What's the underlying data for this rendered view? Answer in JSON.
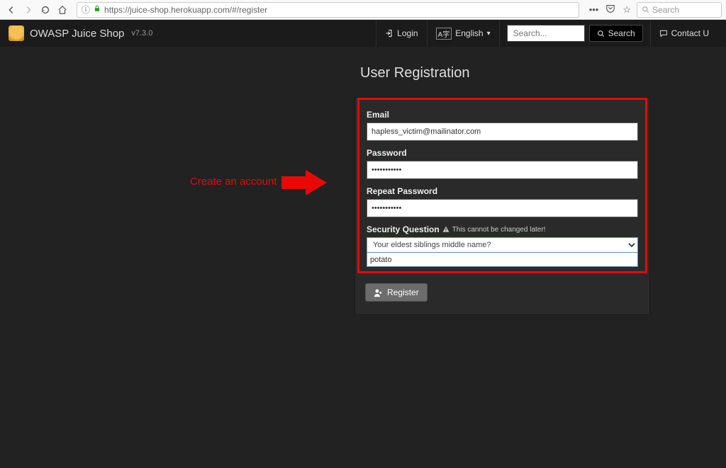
{
  "chrome": {
    "url": "https://juice-shop.herokuapp.com/#/register",
    "search_placeholder": "Search"
  },
  "nav": {
    "brand": "OWASP Juice Shop",
    "version": "v7.3.0",
    "login": "Login",
    "language": "English",
    "search_placeholder": "Search...",
    "search_btn": "Search",
    "contact": "Contact U"
  },
  "page": {
    "title": "User Registration",
    "annotation": "Create an account"
  },
  "form": {
    "email_label": "Email",
    "email_value": "hapless_victim@mailinator.com",
    "password_label": "Password",
    "password_value": "•••••••••••",
    "repeat_label": "Repeat Password",
    "repeat_value": "•••••••••••",
    "secq_label": "Security Question",
    "secq_note": "This cannot be changed later!",
    "secq_selected": "Your eldest siblings middle name?",
    "answer_value": "potato",
    "register_btn": "Register"
  }
}
